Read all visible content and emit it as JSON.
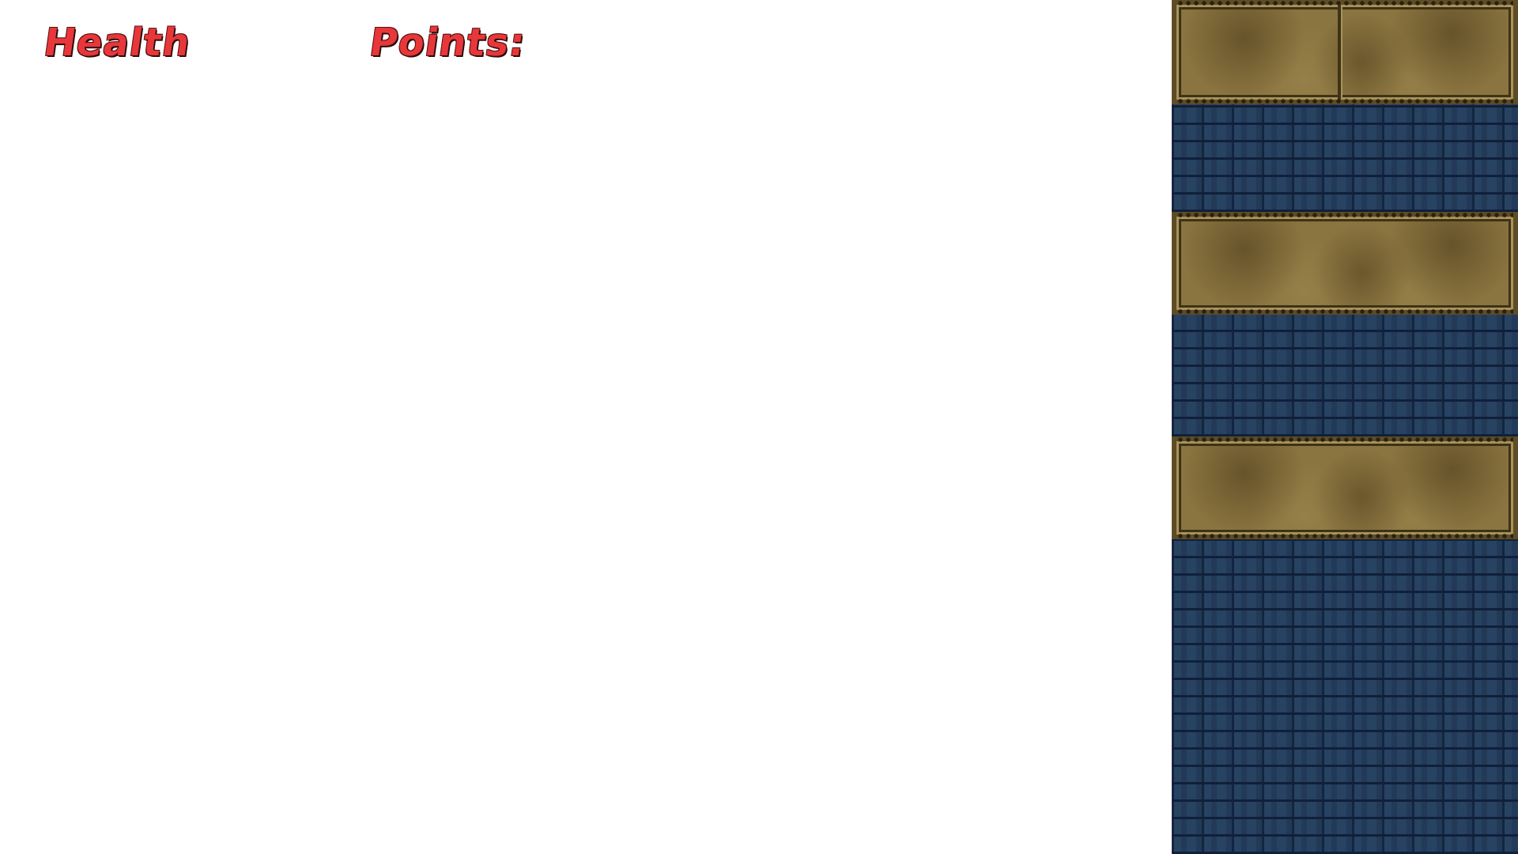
{
  "hud": {
    "health_label": "Health",
    "points_label": "Points:"
  },
  "colors": {
    "hud_text": "#e8373a",
    "background": "#ffffff",
    "brick": "#223a58",
    "metal_panel": "#8a7440"
  }
}
